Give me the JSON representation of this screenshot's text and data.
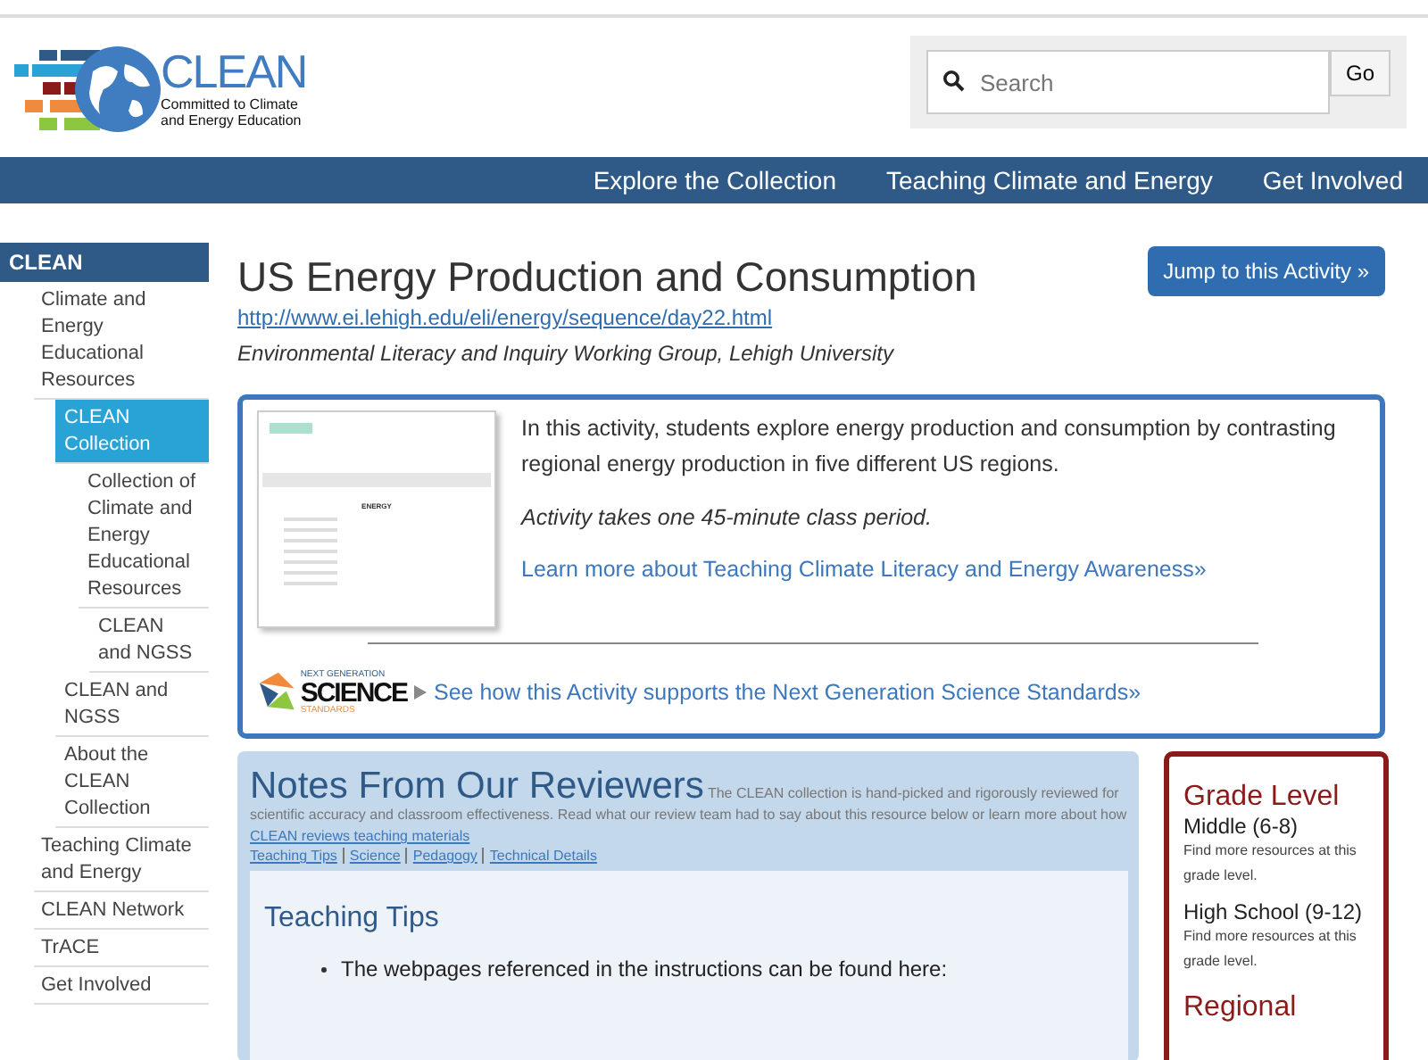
{
  "header": {
    "logo": {
      "name": "CLEAN",
      "tagline": "Committed to Climate and Energy Education"
    },
    "search": {
      "placeholder": "Search",
      "button": "Go"
    }
  },
  "nav": [
    "Explore the Collection",
    "Teaching Climate and Energy",
    "Get Involved"
  ],
  "sidebar": {
    "title": "CLEAN",
    "items": [
      {
        "label": "Climate and Energy Educational Resources",
        "selected": false,
        "children": [
          {
            "label": "CLEAN Collection",
            "selected": true,
            "children": [
              {
                "label": "Collection of Climate and Energy Educational Resources",
                "selected": false,
                "children": [
                  {
                    "label": "CLEAN and NGSS",
                    "selected": false
                  }
                ]
              }
            ]
          },
          {
            "label": "CLEAN and NGSS",
            "selected": false
          },
          {
            "label": "About the CLEAN Collection",
            "selected": false
          }
        ]
      },
      {
        "label": "Teaching Climate and Energy",
        "selected": false
      },
      {
        "label": "CLEAN Network",
        "selected": false
      },
      {
        "label": "TrACE",
        "selected": false
      },
      {
        "label": "Get Involved",
        "selected": false
      }
    ]
  },
  "page": {
    "title": "US Energy Production and Consumption",
    "jump_button": "Jump to this Activity »",
    "url": "http://www.ei.lehigh.edu/eli/energy/sequence/day22.html",
    "source": "Environmental Literacy and Inquiry Working Group, Lehigh University"
  },
  "summary": {
    "thumbnail_heading": "ENERGY",
    "description": "In this activity, students explore energy production and consumption by contrasting regional energy production in five different US regions.",
    "duration": "Activity takes one 45-minute class period.",
    "learn_more": "Learn more about Teaching Climate Literacy and Energy Awareness»",
    "ngss_logo": {
      "top": "NEXT GENERATION",
      "main": "SCIENCE",
      "bottom": "STANDARDS"
    },
    "ngss_link": "See how this Activity supports the Next Generation Science Standards»"
  },
  "reviewers": {
    "title": "Notes From Our Reviewers",
    "intro": "The CLEAN collection is hand-picked and rigorously reviewed for scientific accuracy and classroom effectiveness. Read what our review team had to say about this resource below or learn more about how",
    "intro_link": "CLEAN reviews teaching materials",
    "tabs": [
      "Teaching Tips",
      "Science",
      "Pedagogy",
      "Technical Details"
    ],
    "section_title": "Teaching Tips",
    "tips": [
      "The webpages referenced in the instructions can be found here:"
    ]
  },
  "grade": {
    "title": "Grade Level",
    "levels": [
      {
        "name": "Middle (6-8)",
        "note": "Find more resources at this grade level."
      },
      {
        "name": "High School (9-12)",
        "note": "Find more resources at this grade level."
      }
    ],
    "next_title": "Regional"
  }
}
